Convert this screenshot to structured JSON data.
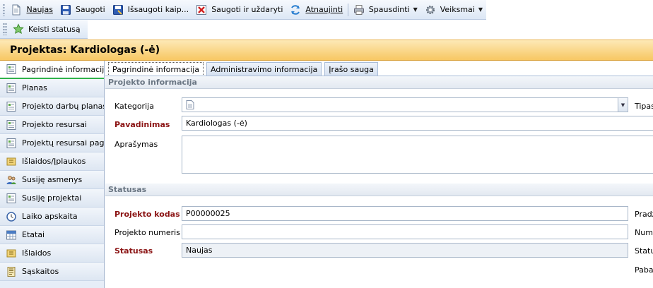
{
  "toolbar": {
    "new": "Naujas",
    "save": "Saugoti",
    "save_as": "Išsaugoti kaip...",
    "save_close": "Saugoti ir uždaryti",
    "refresh": "Atnaujinti",
    "print": "Spausdinti",
    "actions": "Veiksmai",
    "change_status": "Keisti statusą"
  },
  "title": "Projektas: Kardiologas (-ė)",
  "nav": [
    {
      "label": "Pagrindinė informacija",
      "icon": "form-icon"
    },
    {
      "label": "Planas",
      "icon": "form-icon"
    },
    {
      "label": "Projekto darbų planas",
      "icon": "form-icon"
    },
    {
      "label": "Projekto resursai",
      "icon": "form-icon"
    },
    {
      "label": "Projektų resursai pag...",
      "icon": "form-icon"
    },
    {
      "label": "Išlaidos/Įplaukos",
      "icon": "money-icon"
    },
    {
      "label": "Susiję asmenys",
      "icon": "people-icon"
    },
    {
      "label": "Susiję projektai",
      "icon": "form-icon"
    },
    {
      "label": "Laiko apskaita",
      "icon": "clock-icon"
    },
    {
      "label": "Etatai",
      "icon": "table-icon"
    },
    {
      "label": "Išlaidos",
      "icon": "money-icon"
    },
    {
      "label": "Sąskaitos",
      "icon": "invoice-icon"
    }
  ],
  "tabs": [
    "Pagrindinė informacija",
    "Administravimo informacija",
    "Įrašo sauga"
  ],
  "sections": {
    "project_info": "Projekto informacija",
    "status": "Statusas"
  },
  "fields": {
    "category_label": "Kategorija",
    "category_value": "",
    "name_label": "Pavadinimas",
    "name_value": "Kardiologas (-ė)",
    "description_label": "Aprašymas",
    "description_value": "",
    "code_label": "Projekto kodas",
    "code_value": "P00000025",
    "number_label": "Projekto numeris",
    "number_value": "",
    "status_label": "Statusas",
    "status_value": "Naujas"
  },
  "right_labels": {
    "type": "Tipas",
    "start": "Pradž",
    "number": "Numa",
    "status": "Status",
    "end": "Pabai"
  },
  "accent_color": "#2fb24a",
  "required_color": "#8b1414"
}
